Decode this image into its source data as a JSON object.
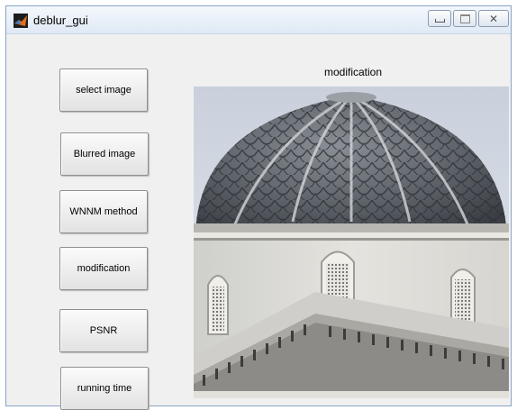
{
  "window": {
    "title": "deblur_gui",
    "controls": {
      "minimize": "minimize",
      "maximize": "maximize",
      "close": "✕"
    }
  },
  "buttons": {
    "select_image": "select image",
    "blurred_image": "Blurred image",
    "wnnm_method": "WNNM method",
    "modification": "modification",
    "psnr": "PSNR",
    "running_time": "running time"
  },
  "axes": {
    "title": "modification",
    "image_subject": "domed building"
  }
}
